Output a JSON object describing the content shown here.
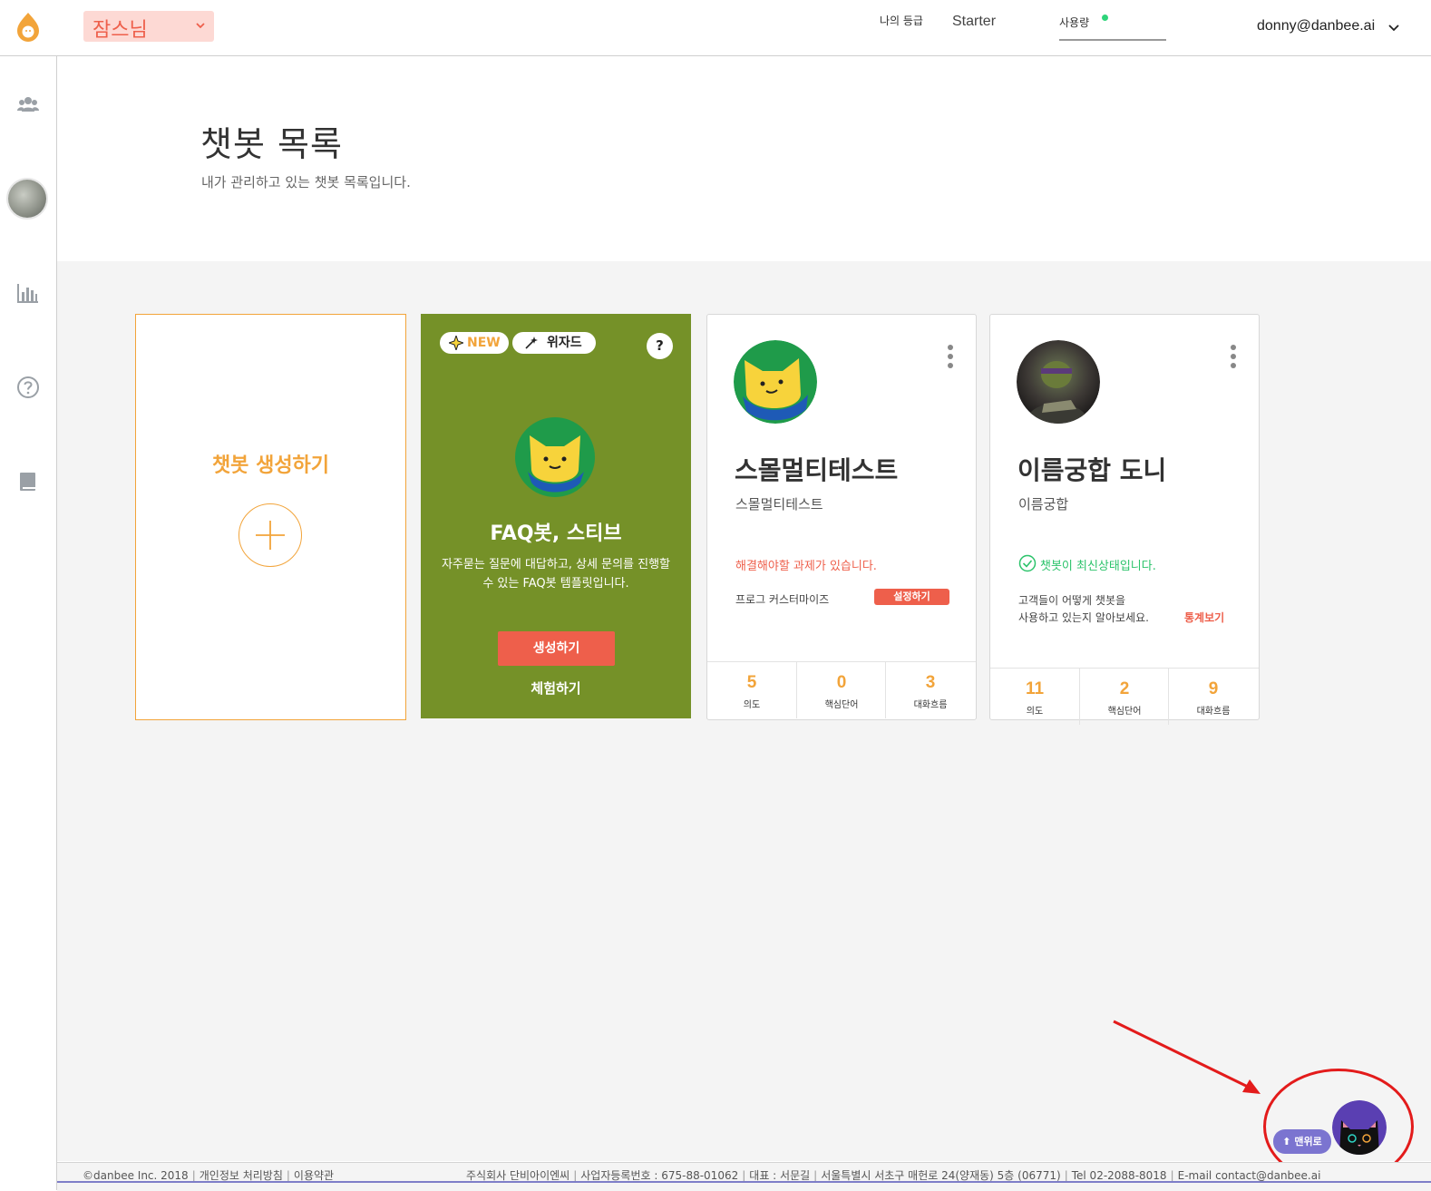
{
  "header": {
    "workspace_name": "잠스님",
    "grade_label": "나의 등급",
    "grade_value": "Starter",
    "usage_label": "사용량",
    "account_email": "donny@danbee.ai"
  },
  "sidebar": {
    "items": [
      {
        "icon": "users-icon"
      },
      {
        "icon": "avatar"
      },
      {
        "icon": "bar-chart-icon"
      },
      {
        "icon": "help-icon"
      },
      {
        "icon": "book-icon"
      }
    ]
  },
  "page": {
    "title": "챗봇 목록",
    "subtitle": "내가 관리하고 있는 챗봇 목록입니다."
  },
  "create_card": {
    "label": "챗봇 생성하기"
  },
  "faq_card": {
    "badge_new": "NEW",
    "badge_wizard": "위자드",
    "help": "?",
    "title": "FAQ봇, 스티브",
    "desc_line1": "자주묻는 질문에 대답하고, 상세 문의를 진행할",
    "desc_line2": "수 있는 FAQ봇 템플릿입니다.",
    "create_button": "생성하기",
    "try_link": "체험하기",
    "bg_color": "#759128"
  },
  "bots": [
    {
      "name": "스몰멀티테스트",
      "desc": "스몰멀티테스트",
      "status": "해결해야할 과제가 있습니다.",
      "task_label": "프로그 커스터마이즈",
      "task_button": "설정하기",
      "metrics": [
        {
          "value": "5",
          "label": "의도"
        },
        {
          "value": "0",
          "label": "핵심단어"
        },
        {
          "value": "3",
          "label": "대화흐름"
        }
      ]
    },
    {
      "name": "이름궁합 도니",
      "desc": "이름궁합",
      "status": "챗봇이 최신상태입니다.",
      "hint_line1": "고객들이 어떻게 챗봇을",
      "hint_line2": "사용하고 있는지 알아보세요.",
      "stats_link": "통계보기",
      "metrics": [
        {
          "value": "11",
          "label": "의도"
        },
        {
          "value": "2",
          "label": "핵심단어"
        },
        {
          "value": "9",
          "label": "대화흐름"
        }
      ]
    }
  ],
  "floating": {
    "to_top": "⬆ 맨위로"
  },
  "footer": {
    "copyright": "©danbee Inc. 2018",
    "privacy": "개인정보 처리방침",
    "terms": "이용약관",
    "company": "주식회사 단비아이엔씨",
    "biz_no": "사업자등록번호 : 675-88-01062",
    "ceo": "대표 : 서문길",
    "address": "서울특별시 서초구 매헌로 24(양재동) 5층 (06771)",
    "tel": "Tel 02-2088-8018",
    "email": "E-mail contact@danbee.ai"
  },
  "colors": {
    "accent_orange": "#f2a43a",
    "accent_red": "#ee5f4b",
    "ok_green": "#2cc36b",
    "annotation_red": "#e31b1b"
  }
}
